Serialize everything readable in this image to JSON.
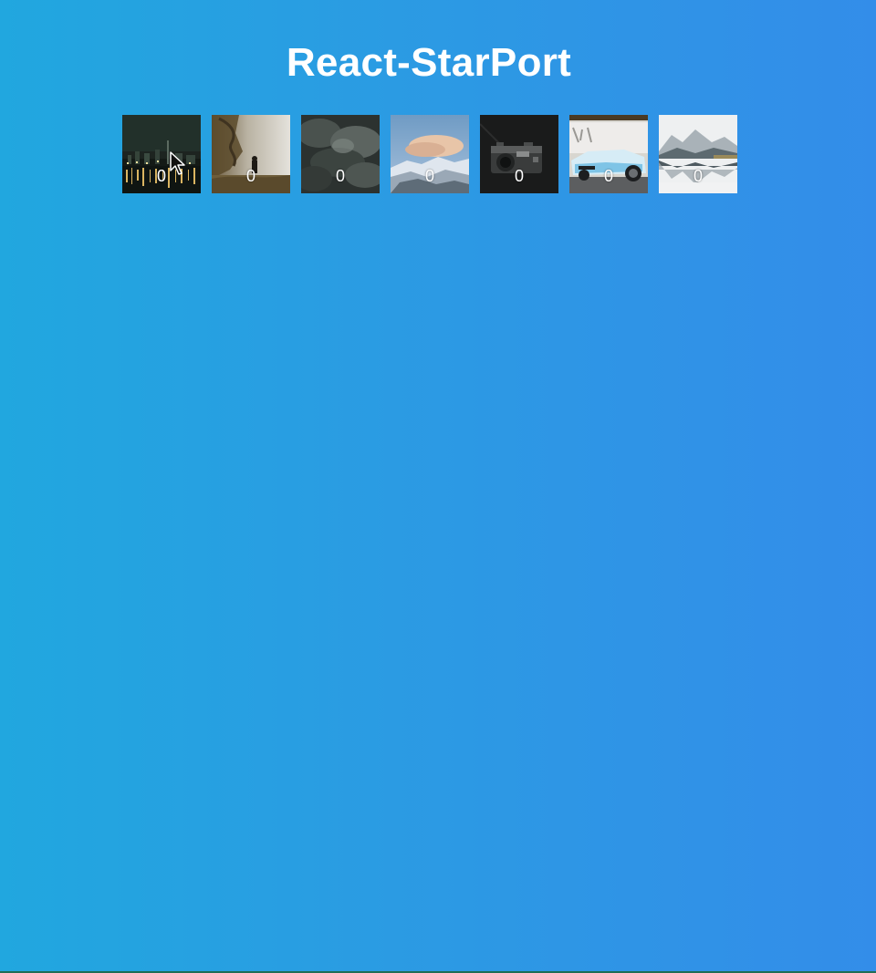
{
  "page": {
    "title": "React-StarPort"
  },
  "gallery": {
    "items": [
      {
        "count": "0",
        "image": "city-skyline-night-photo"
      },
      {
        "count": "0",
        "image": "foggy-forest-person-photo"
      },
      {
        "count": "0",
        "image": "dark-clouds-photo"
      },
      {
        "count": "0",
        "image": "snowy-mountain-sunset-photo"
      },
      {
        "count": "0",
        "image": "vintage-camera-photo"
      },
      {
        "count": "0",
        "image": "blue-sports-car-photo"
      },
      {
        "count": "0",
        "image": "mountain-lake-reflection-photo"
      }
    ]
  },
  "colors": {
    "background_start": "#21a7df",
    "background_end": "#338de9",
    "text": "#ffffff"
  }
}
